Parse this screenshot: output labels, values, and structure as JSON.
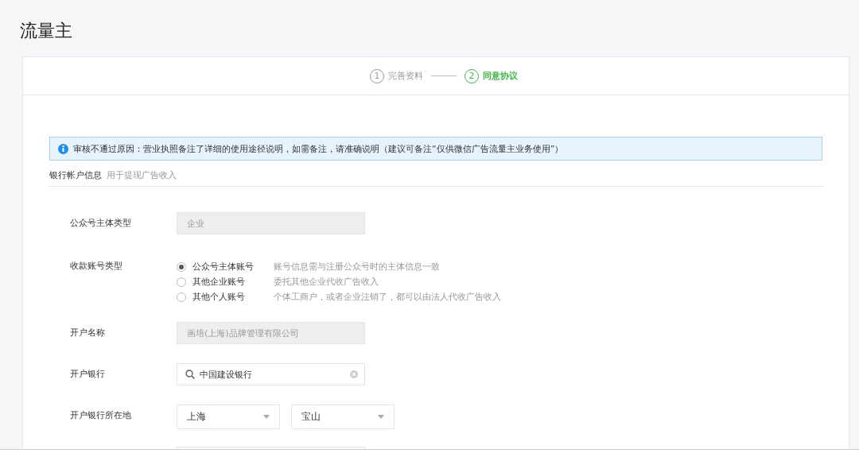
{
  "page_title": "流量主",
  "steps": [
    {
      "number": "1",
      "label": "完善资料",
      "selected": false
    },
    {
      "number": "2",
      "label": "同意协议",
      "selected": true
    }
  ],
  "notice": {
    "text": "审核不通过原因：营业执照备注了详细的使用途径说明，如需备注，请准确说明（建议可备注“仅供微信广告流量主业务使用”）"
  },
  "section": {
    "title": "银行帐户信息",
    "hint": "用于提现广告收入"
  },
  "fields": [
    {
      "kind": "readonly",
      "label": "公众号主体类型",
      "value": "企业"
    },
    {
      "kind": "radio",
      "label": "收款账号类型",
      "options": [
        {
          "label": "公众号主体账号",
          "hint": "账号信息需与注册公众号时的主体信息一致",
          "selected": true
        },
        {
          "label": "其他企业账号",
          "hint": "委托其他企业代收广告收入",
          "selected": false
        },
        {
          "label": "其他个人账号",
          "hint": "个体工商户，或者企业注销了，都可以由法人代收广告收入",
          "selected": false
        }
      ]
    },
    {
      "kind": "readonly",
      "label": "开户名称",
      "value": "画培(上海)品牌管理有限公司"
    },
    {
      "kind": "search",
      "label": "开户银行",
      "value": "中国建设银行"
    },
    {
      "kind": "selects",
      "label": "开户银行所在地",
      "values": [
        "上海",
        "宝山"
      ]
    },
    {
      "kind": "input"
    }
  ]
}
